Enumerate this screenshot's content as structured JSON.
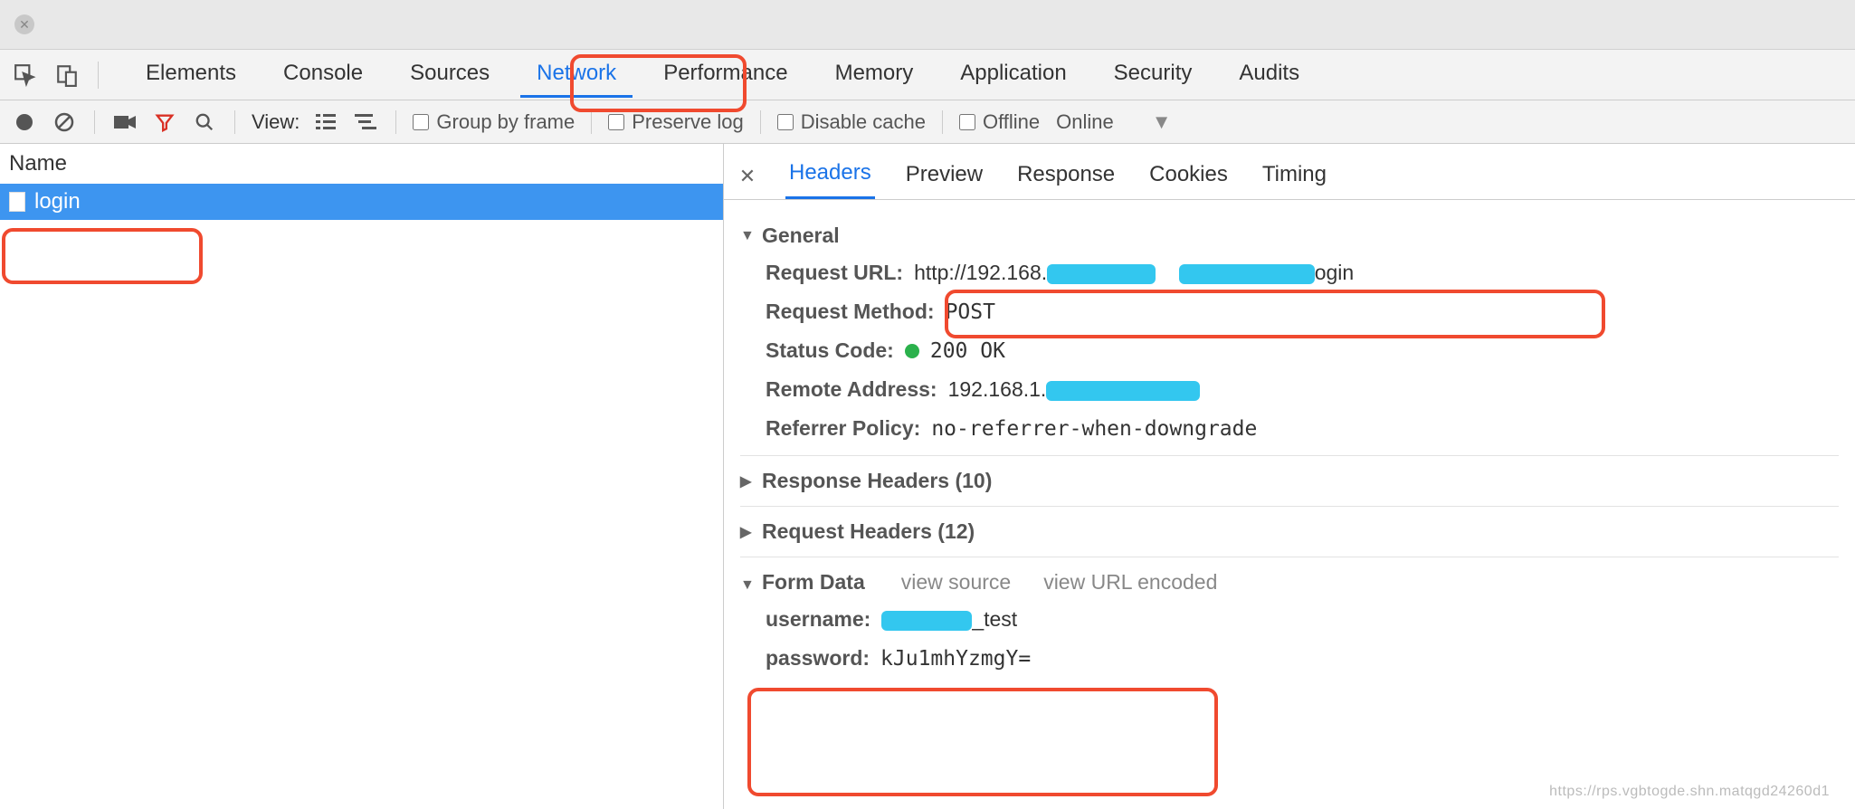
{
  "tabs": {
    "elements": "Elements",
    "console": "Console",
    "sources": "Sources",
    "network": "Network",
    "performance": "Performance",
    "memory": "Memory",
    "application": "Application",
    "security": "Security",
    "audits": "Audits"
  },
  "toolbar": {
    "view_label": "View:",
    "group_by_frame": "Group by frame",
    "preserve_log": "Preserve log",
    "disable_cache": "Disable cache",
    "offline": "Offline",
    "online": "Online"
  },
  "left": {
    "header": "Name",
    "items": [
      {
        "name": "login"
      }
    ]
  },
  "detail": {
    "tabs": {
      "headers": "Headers",
      "preview": "Preview",
      "response": "Response",
      "cookies": "Cookies",
      "timing": "Timing"
    },
    "general": {
      "title": "General",
      "request_url_label": "Request URL:",
      "request_url_prefix": "http://192.168.",
      "request_url_suffix": "ogin",
      "request_method_label": "Request Method:",
      "request_method": "POST",
      "status_code_label": "Status Code:",
      "status_code": "200 OK",
      "remote_address_label": "Remote Address:",
      "remote_address_prefix": "192.168.1.",
      "referrer_policy_label": "Referrer Policy:",
      "referrer_policy": "no-referrer-when-downgrade"
    },
    "response_headers": {
      "title": "Response Headers (10)"
    },
    "request_headers": {
      "title": "Request Headers (12)"
    },
    "form_data": {
      "title": "Form Data",
      "view_source": "view source",
      "view_url_encoded": "view URL encoded",
      "username_label": "username:",
      "username_suffix": "_test",
      "password_label": "password:",
      "password_value": "kJu1mhYzmgY="
    }
  },
  "watermark": "https://rps.vgbtogde.shn.matqgd24260d1"
}
